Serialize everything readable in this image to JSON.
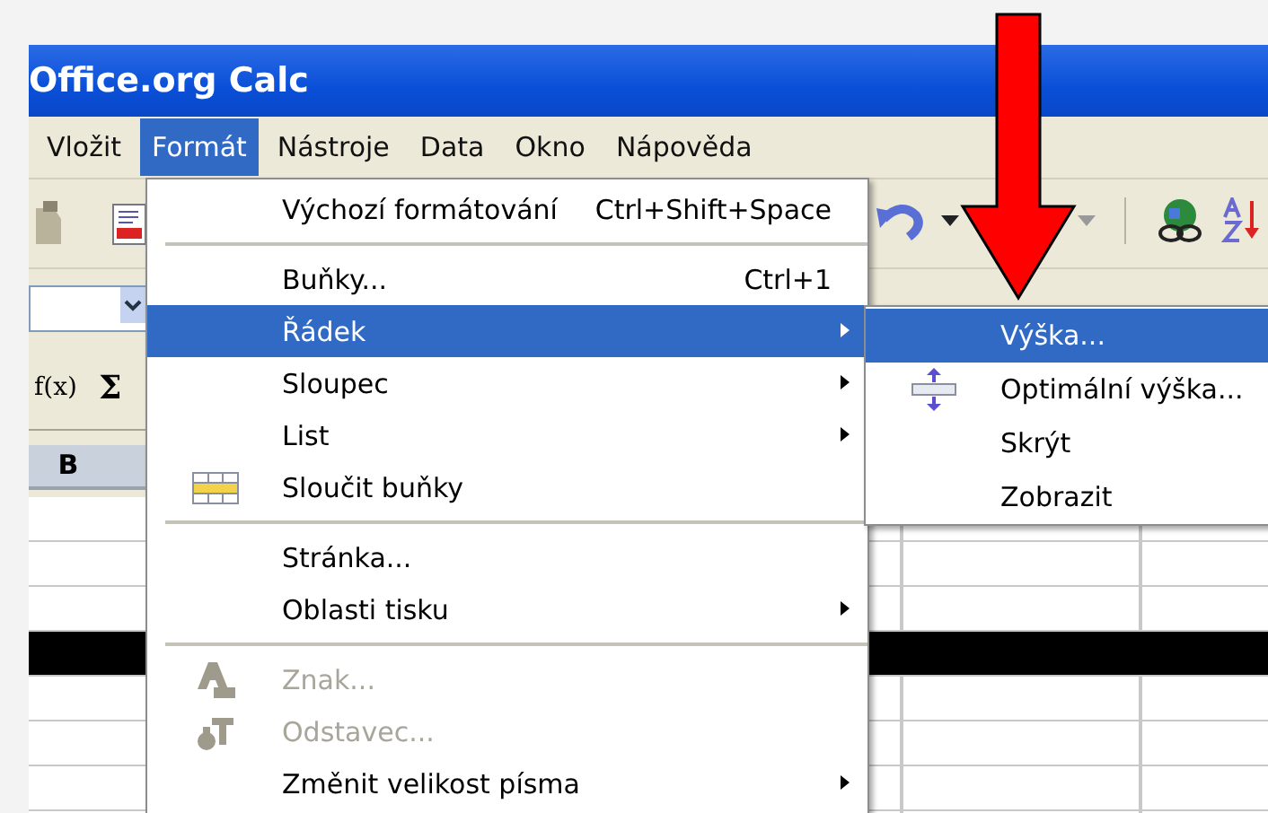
{
  "window": {
    "title": "Office.org Calc"
  },
  "menubar": [
    {
      "label": "Vložit",
      "selected": false
    },
    {
      "label": "Formát",
      "selected": true
    },
    {
      "label": "Nástroje",
      "selected": false
    },
    {
      "label": "Data",
      "selected": false
    },
    {
      "label": "Okno",
      "selected": false
    },
    {
      "label": "Nápověda",
      "selected": false
    }
  ],
  "function_bar": {
    "function_wizard": "f(x)",
    "sum": "Σ"
  },
  "sheet": {
    "column_header": "B",
    "rows": [
      {
        "selected": false
      },
      {
        "selected": false
      },
      {
        "selected": false
      },
      {
        "selected": true
      },
      {
        "selected": false
      },
      {
        "selected": false
      },
      {
        "selected": false
      },
      {
        "selected": false
      }
    ]
  },
  "format_menu": [
    {
      "kind": "item",
      "label": "Výchozí formátování",
      "shortcut": "Ctrl+Shift+Space",
      "submenu": false,
      "selected": false,
      "disabled": false
    },
    {
      "kind": "separator"
    },
    {
      "kind": "item",
      "label": "Buňky...",
      "shortcut": "Ctrl+1",
      "submenu": false,
      "selected": false,
      "disabled": false
    },
    {
      "kind": "item",
      "label": "Řádek",
      "submenu": true,
      "selected": true,
      "disabled": false
    },
    {
      "kind": "item",
      "label": "Sloupec",
      "submenu": true,
      "selected": false,
      "disabled": false
    },
    {
      "kind": "item",
      "label": "List",
      "submenu": true,
      "selected": false,
      "disabled": false
    },
    {
      "kind": "item",
      "label": "Sloučit buňky",
      "submenu": false,
      "selected": false,
      "disabled": false
    },
    {
      "kind": "separator"
    },
    {
      "kind": "item",
      "label": "Stránka...",
      "submenu": false,
      "selected": false,
      "disabled": false
    },
    {
      "kind": "item",
      "label": "Oblasti tisku",
      "submenu": true,
      "selected": false,
      "disabled": false
    },
    {
      "kind": "separator"
    },
    {
      "kind": "item",
      "label": "Znak...",
      "submenu": false,
      "selected": false,
      "disabled": true
    },
    {
      "kind": "item",
      "label": "Odstavec...",
      "submenu": false,
      "selected": false,
      "disabled": true
    },
    {
      "kind": "item",
      "label": "Změnit velikost písma",
      "submenu": true,
      "selected": false,
      "disabled": false
    }
  ],
  "row_submenu": [
    {
      "label": "Výška...",
      "selected": true
    },
    {
      "label": "Optimální výška...",
      "selected": false
    },
    {
      "label": "Skrýt",
      "selected": false
    },
    {
      "label": "Zobrazit",
      "selected": false
    }
  ]
}
